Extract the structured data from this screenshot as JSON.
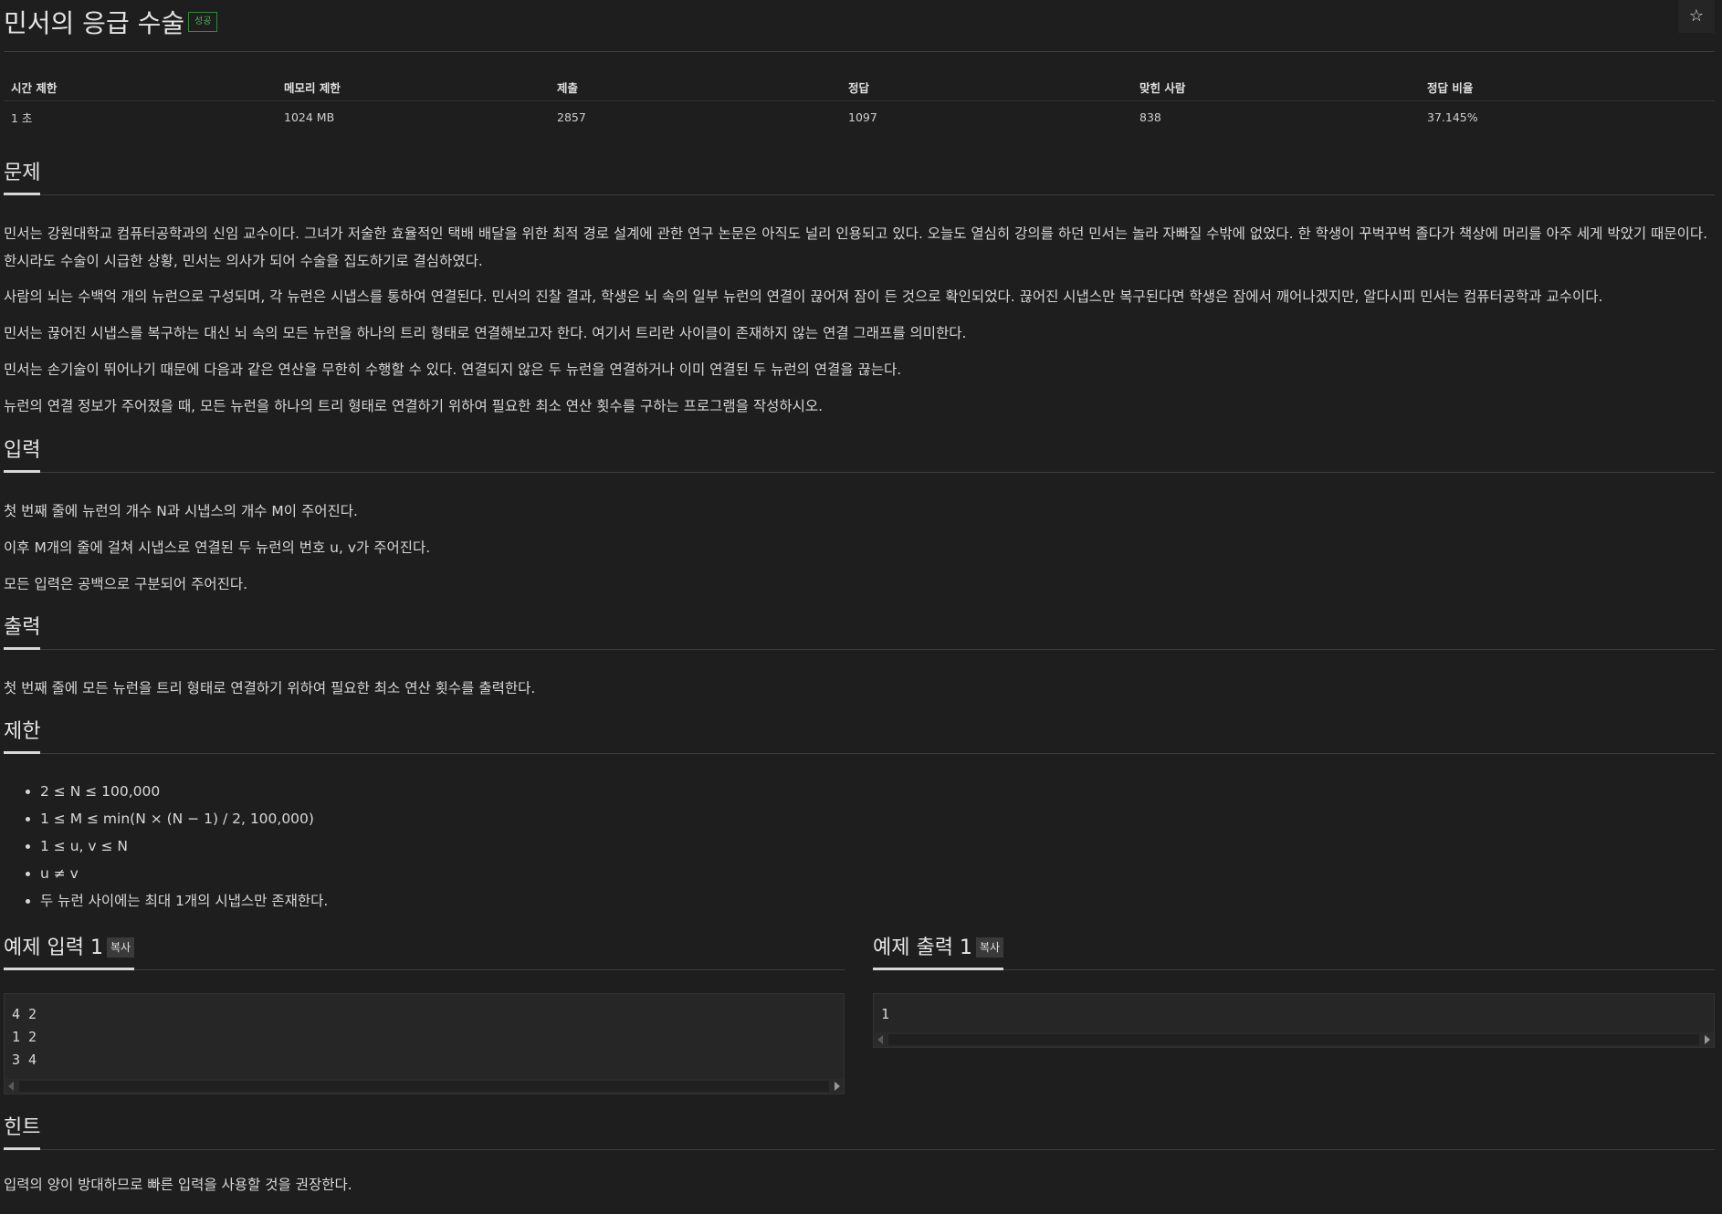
{
  "header": {
    "title": "민서의 응급 수술",
    "badge": "성공",
    "star": "☆"
  },
  "stats": {
    "headers": [
      "시간 제한",
      "메모리 제한",
      "제출",
      "정답",
      "맞힌 사람",
      "정답 비율"
    ],
    "values": [
      "1 초",
      "1024 MB",
      "2857",
      "1097",
      "838",
      "37.145%"
    ]
  },
  "problem": {
    "heading": "문제",
    "paragraphs": [
      "민서는 강원대학교 컴퓨터공학과의 신임 교수이다. 그녀가 저술한 효율적인 택배 배달을 위한 최적 경로 설계에 관한 연구 논문은 아직도 널리 인용되고 있다. 오늘도 열심히 강의를 하던 민서는 놀라 자빠질 수밖에 없었다. 한 학생이 꾸벅꾸벅 졸다가 책상에 머리를 아주 세게 박았기 때문이다. 한시라도 수술이 시급한 상황, 민서는 의사가 되어 수술을 집도하기로 결심하였다.",
      "사람의 뇌는 수백억 개의 뉴런으로 구성되며, 각 뉴런은 시냅스를 통하여 연결된다. 민서의 진찰 결과, 학생은 뇌 속의 일부 뉴런의 연결이 끊어져 잠이 든 것으로 확인되었다. 끊어진 시냅스만 복구된다면 학생은 잠에서 깨어나겠지만, 알다시피 민서는 컴퓨터공학과 교수이다.",
      "민서는 끊어진 시냅스를 복구하는 대신 뇌 속의 모든 뉴런을 하나의 트리 형태로 연결해보고자 한다. 여기서 트리란 사이클이 존재하지 않는 연결 그래프를 의미한다.",
      "민서는 손기술이 뛰어나기 때문에 다음과 같은 연산을 무한히 수행할 수 있다. 연결되지 않은 두 뉴런을 연결하거나 이미 연결된 두 뉴런의 연결을 끊는다.",
      "뉴런의 연결 정보가 주어졌을 때, 모든 뉴런을 하나의 트리 형태로 연결하기 위하여 필요한 최소 연산 횟수를 구하는 프로그램을 작성하시오."
    ]
  },
  "input": {
    "heading": "입력",
    "paragraphs": [
      "첫 번째 줄에 뉴런의 개수 N과 시냅스의 개수 M이 주어진다.",
      "이후 M개의 줄에 걸쳐 시냅스로 연결된 두 뉴런의 번호 u, v가 주어진다.",
      "모든 입력은 공백으로 구분되어 주어진다."
    ]
  },
  "output": {
    "heading": "출력",
    "paragraphs": [
      "첫 번째 줄에 모든 뉴런을 트리 형태로 연결하기 위하여 필요한 최소 연산 횟수를 출력한다."
    ]
  },
  "limits": {
    "heading": "제한",
    "items": [
      "2 ≤ N ≤ 100,000",
      "1 ≤ M ≤ min(N × (N − 1) / 2, 100,000)",
      "1 ≤ u, v ≤ N",
      "u ≠ v",
      "두 뉴런 사이에는 최대 1개의 시냅스만 존재한다."
    ]
  },
  "sample_input": {
    "heading": "예제 입력 1",
    "copy_label": "복사",
    "content": "4 2\n1 2\n3 4"
  },
  "sample_output": {
    "heading": "예제 출력 1",
    "copy_label": "복사",
    "content": "1"
  },
  "hint": {
    "heading": "힌트",
    "paragraphs": [
      "입력의 양이 방대하므로 빠른 입력을 사용할 것을 권장한다."
    ]
  }
}
